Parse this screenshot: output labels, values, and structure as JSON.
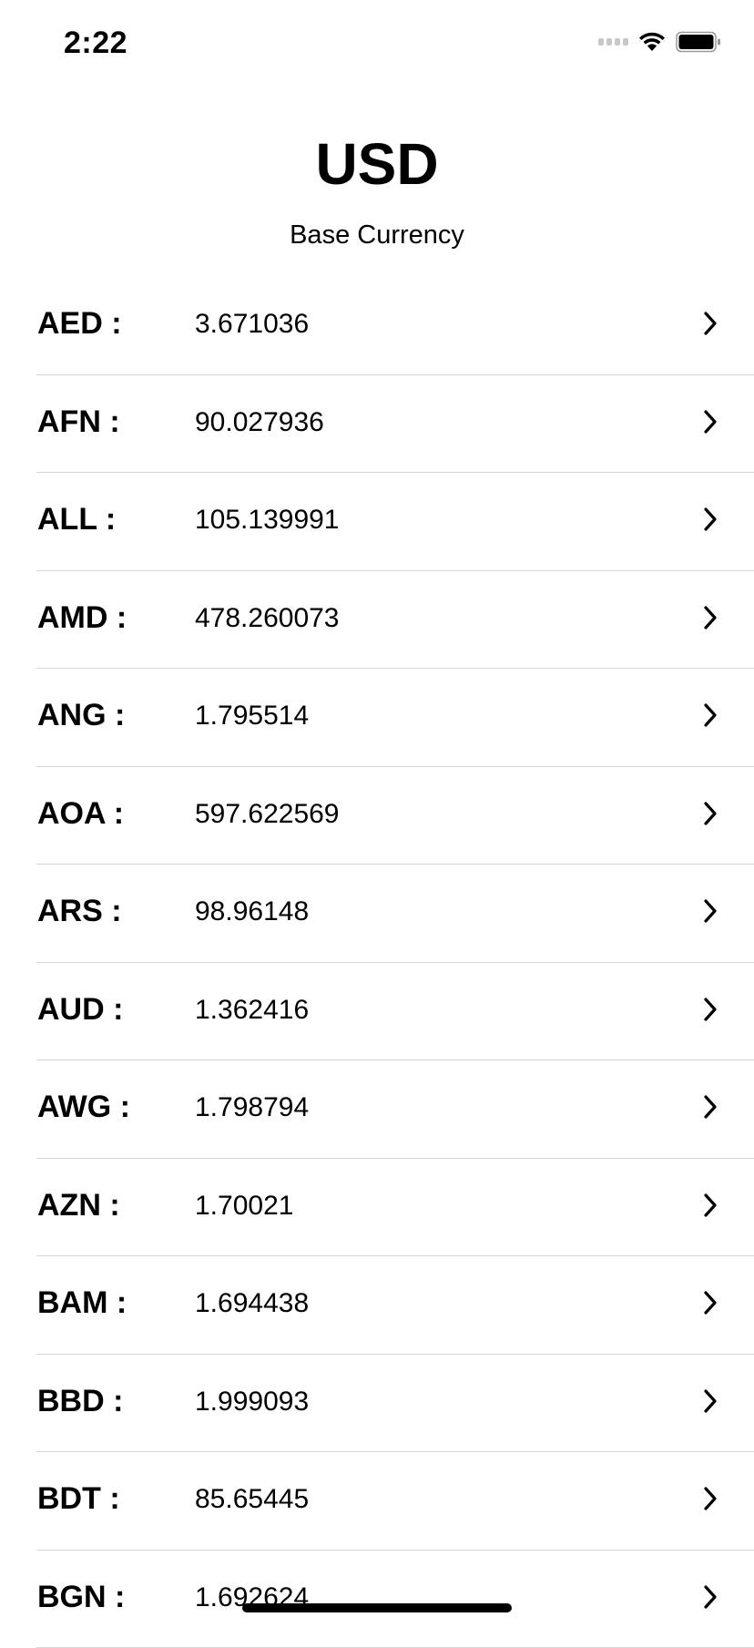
{
  "status_bar": {
    "time": "2:22"
  },
  "header": {
    "base_code": "USD",
    "base_label": "Base Currency"
  },
  "rates": [
    {
      "code": "AED :",
      "value": "3.671036"
    },
    {
      "code": "AFN :",
      "value": "90.027936"
    },
    {
      "code": "ALL :",
      "value": "105.139991"
    },
    {
      "code": "AMD :",
      "value": "478.260073"
    },
    {
      "code": "ANG :",
      "value": "1.795514"
    },
    {
      "code": "AOA :",
      "value": "597.622569"
    },
    {
      "code": "ARS :",
      "value": "98.96148"
    },
    {
      "code": "AUD :",
      "value": "1.362416"
    },
    {
      "code": "AWG :",
      "value": "1.798794"
    },
    {
      "code": "AZN :",
      "value": "1.70021"
    },
    {
      "code": "BAM :",
      "value": "1.694438"
    },
    {
      "code": "BBD :",
      "value": "1.999093"
    },
    {
      "code": "BDT :",
      "value": "85.65445"
    },
    {
      "code": "BGN :",
      "value": "1.692624"
    }
  ],
  "icons": {
    "row_chevron": "chevron-right-icon",
    "wifi": "wifi-icon",
    "battery": "battery-icon",
    "signal": "cellular-signal-icon"
  }
}
